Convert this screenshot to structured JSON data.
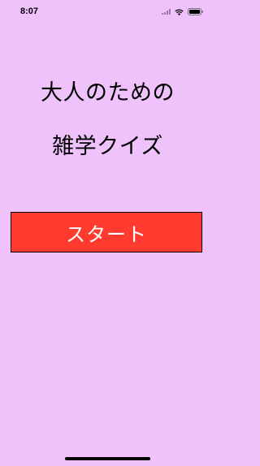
{
  "status_bar": {
    "time": "8:07"
  },
  "title": {
    "line1": "大人のための",
    "line2": "雑学クイズ"
  },
  "start_button": {
    "label": "スタート"
  },
  "colors": {
    "background": "#efc2fb",
    "button": "#ff3b30",
    "button_text": "#ffffff"
  }
}
